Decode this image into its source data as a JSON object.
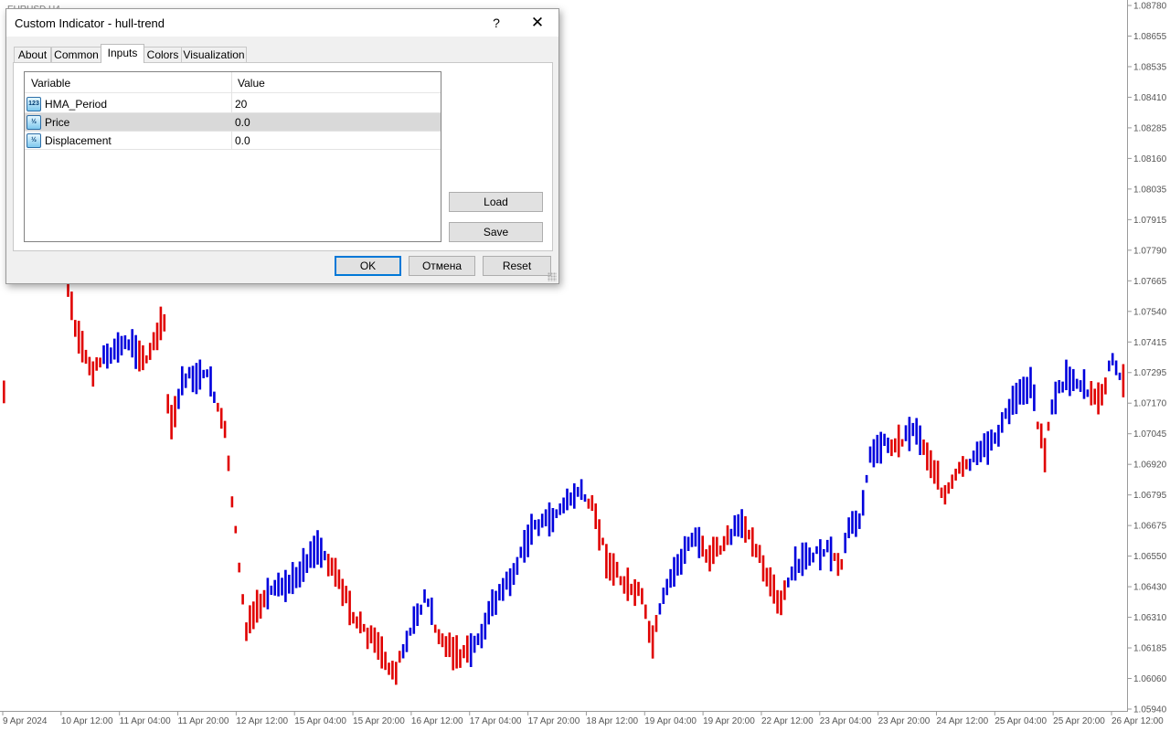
{
  "chart": {
    "symbol": "EURUSD,H4",
    "bull_color": "#0000dd",
    "bear_color": "#e00000",
    "price_axis": {
      "min": 1.0594,
      "max": 1.0878,
      "labels": [
        "1.08780",
        "1.08655",
        "1.08535",
        "1.08410",
        "1.08285",
        "1.08160",
        "1.08035",
        "1.07915",
        "1.07790",
        "1.07665",
        "1.07540",
        "1.07415",
        "1.07295",
        "1.07170",
        "1.07045",
        "1.06920",
        "1.06795",
        "1.06675",
        "1.06550",
        "1.06430",
        "1.06310",
        "1.06185",
        "1.06060",
        "1.05940"
      ]
    },
    "time_axis": [
      "9 Apr 2024",
      "10 Apr 12:00",
      "11 Apr 04:00",
      "11 Apr 20:00",
      "12 Apr 12:00",
      "15 Apr 04:00",
      "15 Apr 20:00",
      "16 Apr 12:00",
      "17 Apr 04:00",
      "17 Apr 20:00",
      "18 Apr 12:00",
      "19 Apr 04:00",
      "19 Apr 20:00",
      "22 Apr 12:00",
      "23 Apr 04:00",
      "23 Apr 20:00",
      "24 Apr 12:00",
      "25 Apr 04:00",
      "25 Apr 20:00",
      "26 Apr 12:00"
    ]
  },
  "dialog": {
    "title": "Custom Indicator - hull-trend",
    "help_label": "?",
    "close_label": "✕",
    "tabs": [
      {
        "label": "About",
        "active": false
      },
      {
        "label": "Common",
        "active": false
      },
      {
        "label": "Inputs",
        "active": true
      },
      {
        "label": "Colors",
        "active": false
      },
      {
        "label": "Visualization",
        "active": false
      }
    ],
    "inputs": {
      "col_variable": "Variable",
      "col_value": "Value",
      "rows": [
        {
          "icon": "int-param-icon",
          "icon_text": "123",
          "name": "HMA_Period",
          "value": "20",
          "selected": false
        },
        {
          "icon": "double-param-icon",
          "icon_text": "½",
          "name": "Price",
          "value": "0.0",
          "selected": true
        },
        {
          "icon": "double-param-icon",
          "icon_text": "½",
          "name": "Displacement",
          "value": "0.0",
          "selected": false
        }
      ]
    },
    "load_label": "Load",
    "save_label": "Save",
    "ok_label": "OK",
    "cancel_label": "Отмена",
    "reset_label": "Reset"
  }
}
